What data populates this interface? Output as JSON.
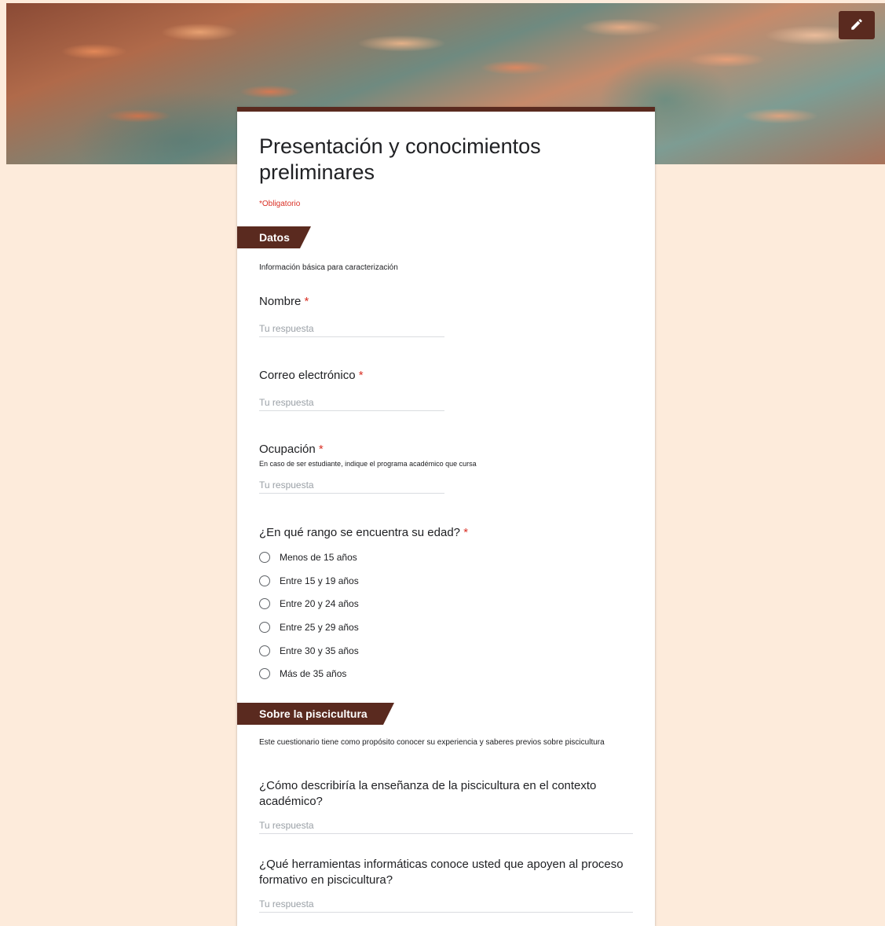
{
  "form": {
    "title": "Presentación y conocimientos preliminares",
    "required_note": "*Obligatorio",
    "edit_icon": "pencil-icon",
    "accent_color": "#5a2a1f",
    "background_color": "#fdebdb"
  },
  "sections": [
    {
      "title": "Datos",
      "description": "Información básica para caracterización"
    },
    {
      "title": "Sobre la piscicultura",
      "description": "Este cuestionario tiene como propósito conocer su experiencia y saberes previos sobre piscicultura"
    }
  ],
  "questions": {
    "nombre": {
      "label": "Nombre",
      "required": "*",
      "placeholder": "Tu respuesta"
    },
    "correo": {
      "label": "Correo electrónico",
      "required": "*",
      "placeholder": "Tu respuesta"
    },
    "ocupacion": {
      "label": "Ocupación",
      "required": "*",
      "help": "En caso de ser estudiante, indique el programa académico que cursa",
      "placeholder": "Tu respuesta"
    },
    "edad": {
      "label": "¿En qué rango se encuentra su edad?",
      "required": "*",
      "options": [
        "Menos de 15 años",
        "Entre 15 y 19 años",
        "Entre 20 y 24 años",
        "Entre 25 y 29 años",
        "Entre 30 y 35 años",
        "Más de 35 años"
      ]
    },
    "ensenanza": {
      "label": "¿Cómo describiría la enseñanza de la piscicultura en el contexto académico?",
      "placeholder": "Tu respuesta"
    },
    "herramientas": {
      "label": "¿Qué herramientas informáticas conoce usted que apoyen al proceso formativo en piscicultura?",
      "placeholder": "Tu respuesta"
    }
  }
}
